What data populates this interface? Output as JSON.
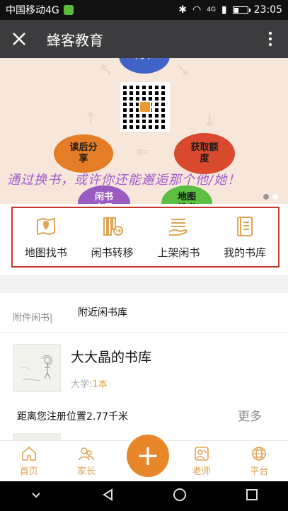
{
  "status_bar": {
    "carrier": "中国移动4G",
    "network": "4G",
    "time": "23:05"
  },
  "title_bar": {
    "title": "蜂客教育"
  },
  "banner": {
    "labels": {
      "top": "闲书",
      "read": "读后分享",
      "get": "获取额度",
      "trade": "闲书交易",
      "map": "地图找书"
    },
    "slogan": "通过换书，或许你还能邂逅那个他/她！",
    "pages": 2,
    "active_page": 2
  },
  "quick_nav": [
    {
      "label": "地图找书",
      "icon": "map-book-icon"
    },
    {
      "label": "闲书转移",
      "icon": "book-transfer-icon"
    },
    {
      "label": "上架闲书",
      "icon": "hand-shelf-icon"
    },
    {
      "label": "我的书库",
      "icon": "library-icon"
    }
  ],
  "section": {
    "tag": "附件闲书|",
    "title": "附近闲书库"
  },
  "library": {
    "name": "大大晶的书库",
    "type": "大学:",
    "count": "1本",
    "distance": "距离您注册位置2.77千米",
    "more": "更多"
  },
  "tab_bar": [
    {
      "label": "首页",
      "icon": "home-icon"
    },
    {
      "label": "家长",
      "icon": "parent-icon"
    },
    {
      "label": "",
      "icon": "add-icon"
    },
    {
      "label": "老师",
      "icon": "teacher-icon"
    },
    {
      "label": "平台",
      "icon": "globe-icon"
    }
  ],
  "colors": {
    "accent": "#e8872a",
    "title_bar": "#3c3c3e",
    "nav_border": "#c0392b",
    "icon_orange": "#e0a455"
  }
}
